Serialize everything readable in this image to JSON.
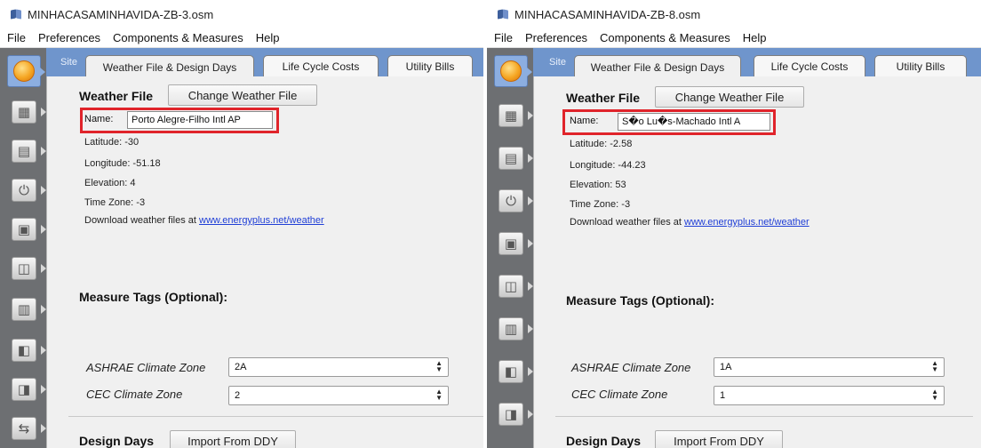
{
  "left": {
    "window_title": "MINHACASAMINHAVIDA-ZB-3.osm",
    "menu": [
      "File",
      "Preferences",
      "Components & Measures",
      "Help"
    ],
    "tabs": {
      "site": "Site",
      "weather": "Weather File & Design Days",
      "lifecycle": "Life Cycle Costs",
      "utility": "Utility Bills"
    },
    "weather_file_label": "Weather File",
    "change_button": "Change Weather File",
    "name_label": "Name:",
    "name_value": "Porto Alegre-Filho Intl AP",
    "latitude": "Latitude: -30",
    "longitude": "Longitude: -51.18",
    "elevation": "Elevation: 4",
    "timezone": "Time Zone: -3",
    "download_prefix": "Download weather files at ",
    "download_link": "www.energyplus.net/weather",
    "measure_tags": "Measure Tags (Optional):",
    "ashrae_label": "ASHRAE Climate Zone",
    "ashrae_value": "2A",
    "cec_label": "CEC Climate Zone",
    "cec_value": "2",
    "design_days": "Design Days",
    "import_button": "Import From DDY"
  },
  "right": {
    "window_title": "MINHACASAMINHAVIDA-ZB-8.osm",
    "menu": [
      "File",
      "Preferences",
      "Components & Measures",
      "Help"
    ],
    "tabs": {
      "site": "Site",
      "weather": "Weather File & Design Days",
      "lifecycle": "Life Cycle Costs",
      "utility": "Utility Bills"
    },
    "weather_file_label": "Weather File",
    "change_button": "Change Weather File",
    "name_label": "Name:",
    "name_value": "S�o Lu�s-Machado Intl A",
    "latitude": "Latitude: -2.58",
    "longitude": "Longitude: -44.23",
    "elevation": "Elevation: 53",
    "timezone": "Time Zone: -3",
    "download_prefix": "Download weather files at ",
    "download_link": "www.energyplus.net/weather",
    "measure_tags": "Measure Tags (Optional):",
    "ashrae_label": "ASHRAE Climate Zone",
    "ashrae_value": "1A",
    "cec_label": "CEC Climate Zone",
    "cec_value": "1",
    "design_days": "Design Days",
    "import_button": "Import From DDY"
  },
  "sidebar_icons": [
    "sun-icon",
    "calendar-icon",
    "constructions-icon",
    "loads-icon",
    "space-types-icon",
    "geometry-icon",
    "facility-icon",
    "spaces-icon",
    "thermal-zones-icon",
    "hvac-icon"
  ],
  "colors": {
    "tab_strip": "#6f95cc",
    "sidebar": "#6d6f72",
    "highlight_box": "#e0242b",
    "link": "#1f3ed6"
  }
}
